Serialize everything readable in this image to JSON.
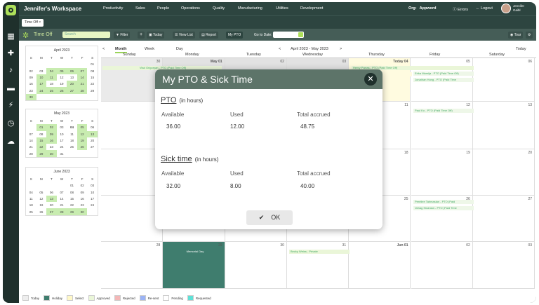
{
  "app": {
    "workspace": "Jennifer's Workspace",
    "nav": [
      "Productivity",
      "Sales",
      "People",
      "Operations",
      "Quality",
      "Manufacturing",
      "Utilities",
      "Development"
    ],
    "org_label": "Org:",
    "org_value": "Appword",
    "errors": "Errors",
    "logout": "Logout",
    "user_first": "Jennifer",
    "user_last": "Gaibl"
  },
  "tab": {
    "label": "Time Off",
    "close": "×"
  },
  "toolbar": {
    "title": "Time Off",
    "search_placeholder": "Search",
    "filter": "Filter",
    "add": "+",
    "today": "Today",
    "view_list": "View List",
    "report": "Report",
    "my_pto": "My PTO",
    "go_to_date": "Go to Date:",
    "tour": "Tour"
  },
  "mini_cals": [
    {
      "title": "April 2023",
      "days": [
        "S",
        "M",
        "T",
        "W",
        "T",
        "F",
        "S"
      ],
      "rows": [
        [
          "",
          "",
          "",
          "",
          "",
          "",
          "01"
        ],
        [
          "02",
          "03",
          "04",
          "05",
          "06",
          "07",
          "08"
        ],
        [
          "09",
          "10",
          "11",
          "12",
          "13",
          "14",
          "15"
        ],
        [
          "16",
          "17",
          "18",
          "19",
          "20",
          "21",
          "22"
        ],
        [
          "23",
          "24",
          "25",
          "26",
          "27",
          "28",
          "29"
        ],
        [
          "30",
          "",
          "",
          "",
          "",
          "",
          ""
        ]
      ]
    },
    {
      "title": "May 2023",
      "days": [
        "S",
        "M",
        "T",
        "W",
        "T",
        "F",
        "S"
      ],
      "rows": [
        [
          "",
          "01",
          "02",
          "03",
          "04",
          "05",
          "06"
        ],
        [
          "07",
          "08",
          "09",
          "10",
          "11",
          "12",
          "13"
        ],
        [
          "14",
          "15",
          "16",
          "17",
          "18",
          "19",
          "20"
        ],
        [
          "21",
          "22",
          "23",
          "24",
          "25",
          "26",
          "27"
        ],
        [
          "28",
          "29",
          "30",
          "31",
          "",
          "",
          ""
        ]
      ]
    },
    {
      "title": "June 2023",
      "days": [
        "S",
        "M",
        "T",
        "W",
        "T",
        "F",
        "S"
      ],
      "rows": [
        [
          "",
          "",
          "",
          "",
          "01",
          "02",
          "03"
        ],
        [
          "04",
          "05",
          "06",
          "07",
          "08",
          "09",
          "10"
        ],
        [
          "11",
          "12",
          "13",
          "14",
          "15",
          "16",
          "17"
        ],
        [
          "18",
          "19",
          "20",
          "21",
          "22",
          "23",
          "24"
        ],
        [
          "25",
          "26",
          "27",
          "28",
          "29",
          "30",
          ""
        ]
      ]
    }
  ],
  "calendar": {
    "views": [
      "Month",
      "Week",
      "Day"
    ],
    "range": "April 2023 - May 2023",
    "prev": "<",
    "next": ">",
    "today": "Today",
    "weekdays": [
      "Sunday",
      "Monday",
      "Tuesday",
      "Wednesday",
      "Thursday",
      "Friday",
      "Saturday"
    ],
    "week1": [
      "30",
      "May 01",
      "02",
      "03",
      "Today 04",
      "05",
      "06"
    ],
    "week2": [
      "07",
      "08",
      "09",
      "10",
      "11",
      "12",
      "13"
    ],
    "week3": [
      "14",
      "15",
      "16",
      "17",
      "18",
      "19",
      "20"
    ],
    "week4": [
      "21",
      "22",
      "23",
      "24",
      "25",
      "26",
      "27"
    ],
    "week5": [
      "28",
      "29",
      "30",
      "31",
      "Jun 01",
      "02",
      "03"
    ],
    "events": {
      "vlad": "Vlad Grigoryan - PTO (Paid Time Off)",
      "henry": "Henry Parras - PTO (Paid Time Off)",
      "erika": "Erika Mamija - PTO (Paid Time Off)",
      "jonathan": "Jonathan Hong - PTO (Paid Time",
      "ova": "ovanian - PT...",
      "paul": "Paul Ko - PTO (Paid Time Off)",
      "pereliee": "Pereliee Tahmasian - PTO (Paid",
      "vahag": "Vahag Sinanian - PTO (Paid Time",
      "memorial": "Memorial Day",
      "becky": "Becky Weiss - Private"
    }
  },
  "legend": [
    "Today",
    "Holiday",
    "Select",
    "Approved",
    "Rejected",
    "Re-sent",
    "Pending",
    "Requested"
  ],
  "legend_colors": [
    "#eeeeee",
    "#3f7d6e",
    "#fff8c8",
    "#eaf6d8",
    "#f3b7b7",
    "#9bb3f5",
    "#ffffff",
    "#5fe0d6"
  ],
  "modal": {
    "title": "My PTO & Sick Time",
    "close": "✕",
    "pto": {
      "title": "PTO",
      "unit": "(in hours)",
      "available_label": "Available",
      "used_label": "Used",
      "total_label": "Total accrued",
      "available": "36.00",
      "used": "12.00",
      "total": "48.75"
    },
    "sick": {
      "title": "Sick time",
      "unit": "(in hours)",
      "available_label": "Available",
      "used_label": "Used",
      "total_label": "Total accrued",
      "available": "32.00",
      "used": "8.00",
      "total": "40.00"
    },
    "ok": "OK"
  }
}
